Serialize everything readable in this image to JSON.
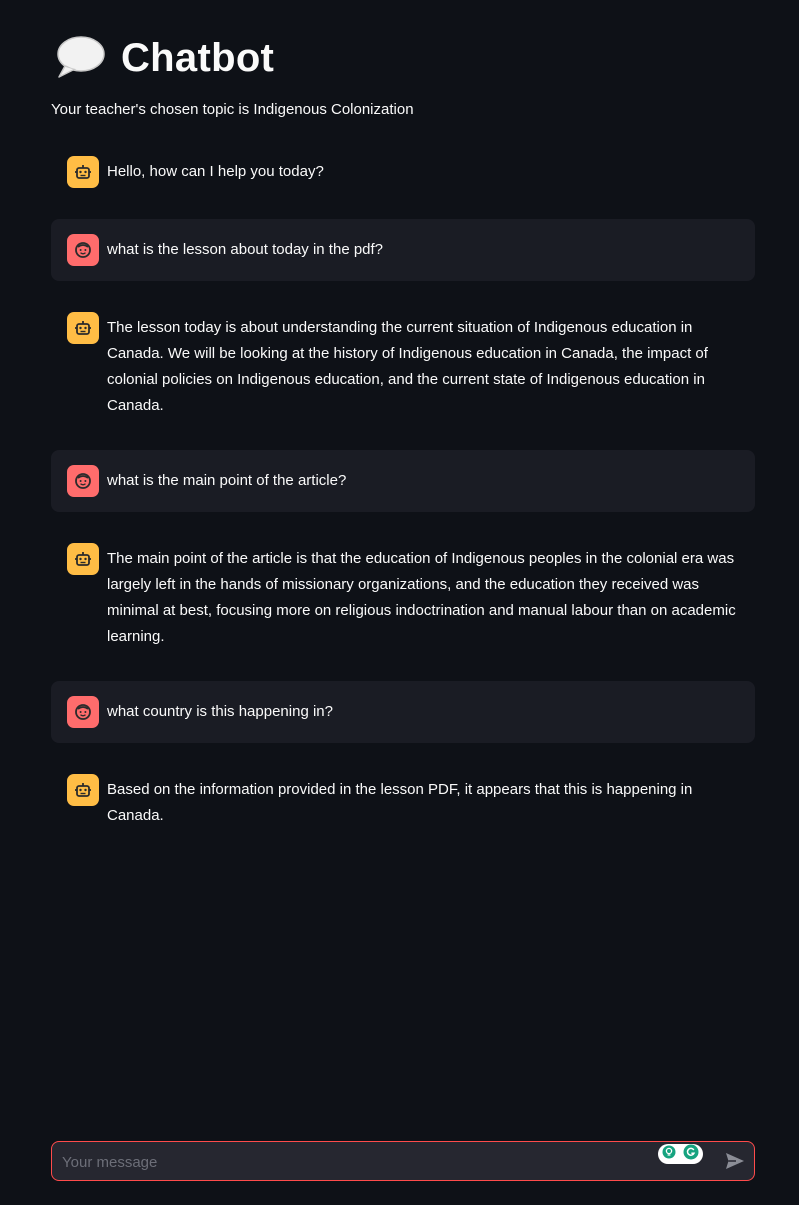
{
  "app": {
    "title": "Chatbot",
    "title_icon": "speech-bubble-icon",
    "subtitle": "Your teacher's chosen topic is Indigenous Colonization"
  },
  "colors": {
    "background": "#0e1117",
    "user_message_bg": "#1a1c24",
    "bot_avatar": "#ffbd45",
    "user_avatar": "#ff6c6c",
    "input_border": "#ff4b4b"
  },
  "messages": [
    {
      "role": "assistant",
      "avatar_icon": "robot-icon",
      "text": "Hello, how can I help you today?"
    },
    {
      "role": "user",
      "avatar_icon": "face-icon",
      "text": "what is the lesson about today in the pdf?"
    },
    {
      "role": "assistant",
      "avatar_icon": "robot-icon",
      "text": "The lesson today is about understanding the current situation of Indigenous education in Canada. We will be looking at the history of Indigenous education in Canada, the impact of colonial policies on Indigenous education, and the current state of Indigenous education in Canada."
    },
    {
      "role": "user",
      "avatar_icon": "face-icon",
      "text": "what is the main point of the article?"
    },
    {
      "role": "assistant",
      "avatar_icon": "robot-icon",
      "text": "The main point of the article is that the education of Indigenous peoples in the colonial era was largely left in the hands of missionary organizations, and the education they received was minimal at best, focusing more on religious indoctrination and manual labour than on academic learning."
    },
    {
      "role": "user",
      "avatar_icon": "face-icon",
      "text": "what country is this happening in?"
    },
    {
      "role": "assistant",
      "avatar_icon": "robot-icon",
      "text": "Based on the information provided in the lesson PDF, it appears that this is happening in Canada."
    }
  ],
  "chat_input": {
    "placeholder": "Your message",
    "value": "",
    "send_icon": "send-icon",
    "extension_icons": [
      "bulb-icon",
      "grammarly-icon"
    ]
  }
}
